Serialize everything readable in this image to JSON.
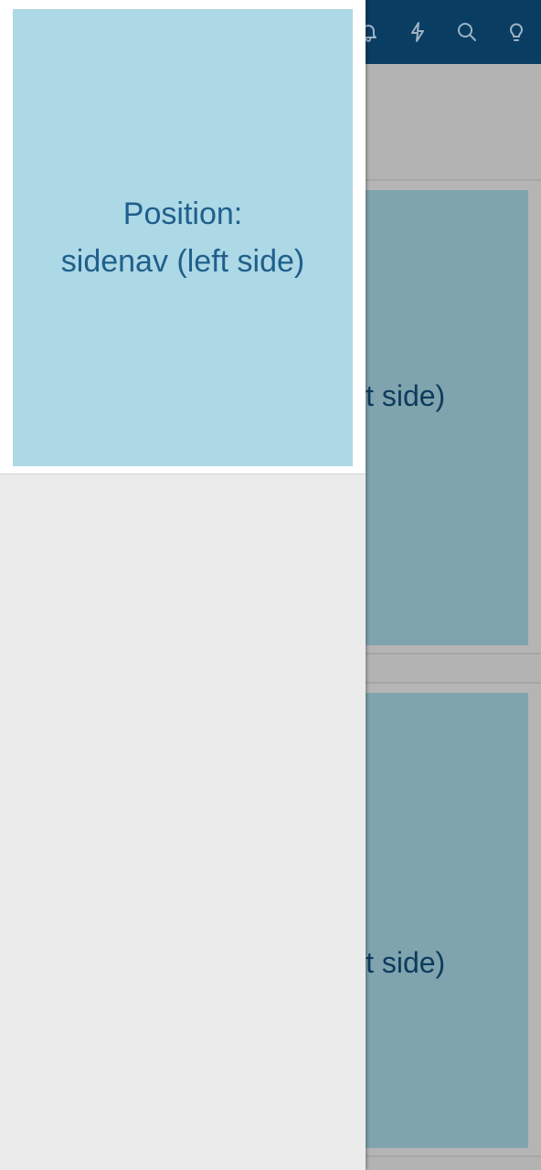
{
  "appbar": {
    "icons": [
      "bell-icon",
      "flash-icon",
      "search-icon",
      "lightbulb-icon"
    ],
    "color": "#0a3d62"
  },
  "content": {
    "card1_text": "Position: sidenav (left side)",
    "card2_text": "Position: sidenav (left side)"
  },
  "sidenav": {
    "panel_line1": "Position:",
    "panel_line2": "sidenav (left side)",
    "panel_color": "#add8e6"
  }
}
